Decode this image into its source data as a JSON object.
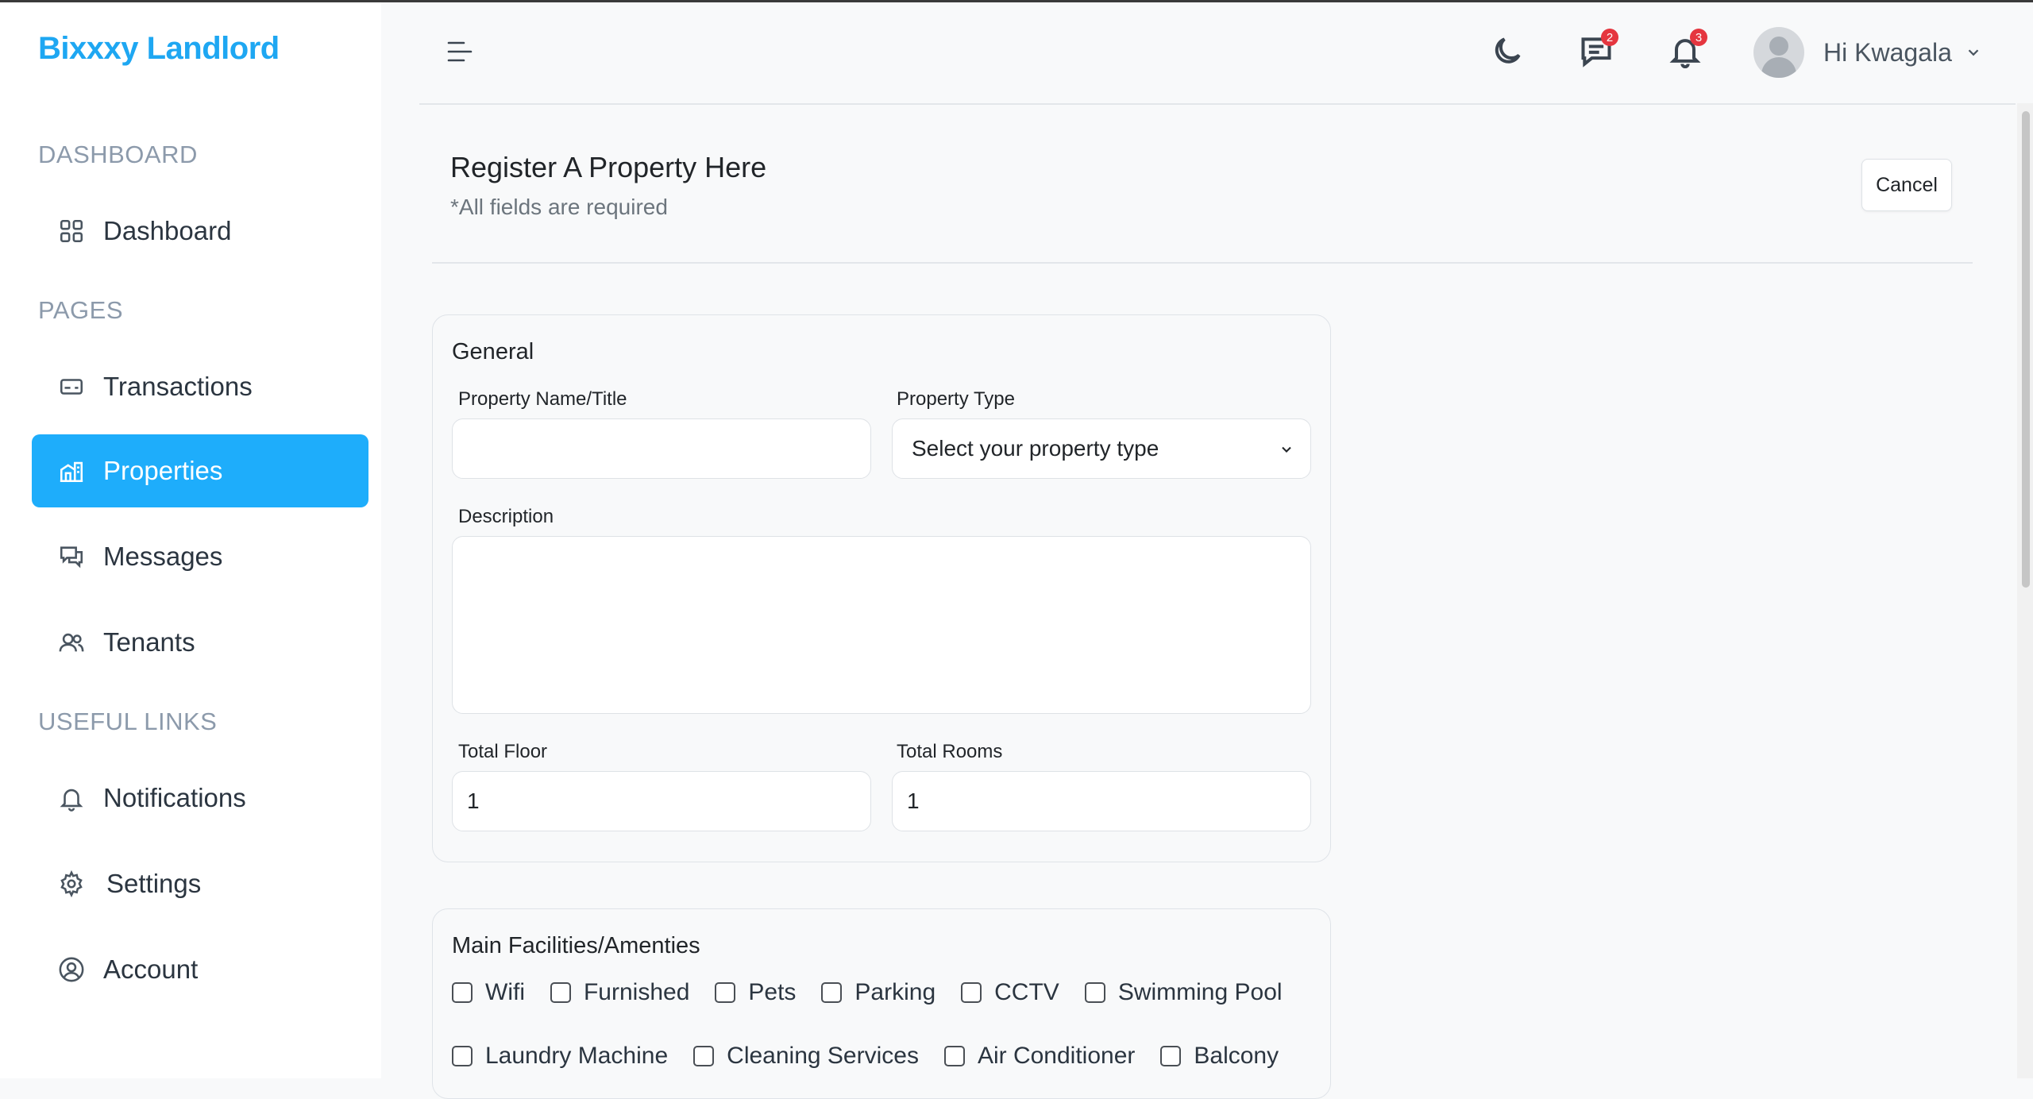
{
  "brand": "Bixxxy Landlord",
  "sidebar": {
    "sections": [
      "DASHBOARD",
      "PAGES",
      "USEFUL LINKS"
    ],
    "items": [
      {
        "label": "Dashboard",
        "icon": "grid-icon"
      },
      {
        "label": "Transactions",
        "icon": "card-icon"
      },
      {
        "label": "Properties",
        "icon": "buildings-icon",
        "active": true
      },
      {
        "label": "Messages",
        "icon": "chat-icon"
      },
      {
        "label": "Tenants",
        "icon": "users-icon"
      },
      {
        "label": "Notifications",
        "icon": "bell-icon"
      },
      {
        "label": "Settings",
        "icon": "gear-icon"
      },
      {
        "label": "Account",
        "icon": "user-circle-icon"
      }
    ]
  },
  "header": {
    "messages_badge": "2",
    "notifications_badge": "3",
    "user_greeting": "Hi Kwagala"
  },
  "page": {
    "title": "Register A Property Here",
    "subtitle": "*All fields are required",
    "cancel_label": "Cancel"
  },
  "general": {
    "title": "General",
    "property_name_label": "Property Name/Title",
    "property_name_value": "",
    "property_type_label": "Property Type",
    "property_type_value": "Select your property type",
    "description_label": "Description",
    "total_floor_label": "Total Floor",
    "total_floor_value": "1",
    "total_rooms_label": "Total Rooms",
    "total_rooms_value": "1"
  },
  "facilities": {
    "title": "Main Facilities/Amenties",
    "row1": [
      "Wifi",
      "Furnished",
      "Pets",
      "Parking",
      "CCTV",
      "Swimming Pool"
    ],
    "row2": [
      "Laundry Machine",
      "Cleaning Services",
      "Air Conditioner",
      "Balcony"
    ]
  },
  "colors": {
    "brand": "#1ea7f2",
    "active_nav": "#1eadfb",
    "badge": "#e5363f"
  }
}
